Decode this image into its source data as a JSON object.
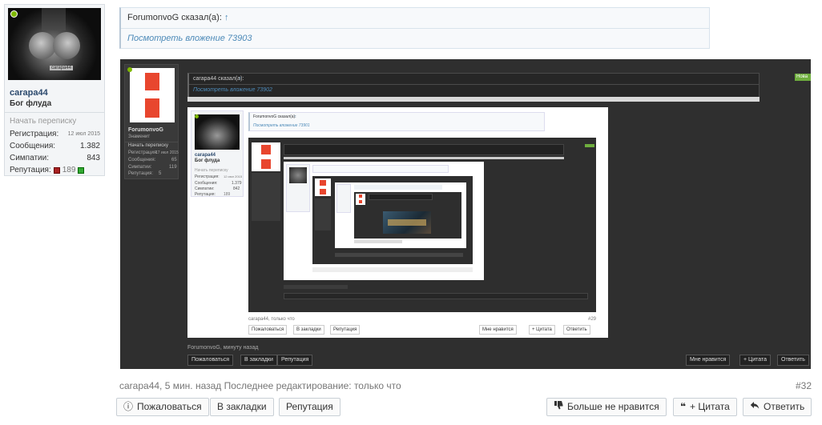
{
  "user": {
    "name": "carapa44",
    "title": "Бог флуда",
    "start_conversation": "Начать переписку",
    "stats": [
      {
        "label": "Регистрация:",
        "value": "12 июл 2015"
      },
      {
        "label": "Сообщения:",
        "value": "1.382"
      },
      {
        "label": "Симпатии:",
        "value": "843"
      }
    ],
    "reputation_label": "Репутация:",
    "reputation_value": "189",
    "avatar_tag": "carapa44"
  },
  "quote": {
    "author": "ForumonvoG сказал(а):",
    "arrow": "↑",
    "attachment_link": "Посмотреть вложение 73903"
  },
  "attachment": {
    "level1": {
      "quote_author": "carapa44 сказал(а):",
      "quote_arrow": "↑",
      "attachment_link": "Посмотреть вложение 73902",
      "new_badge": "Нова",
      "user_name": "ForumonvoG",
      "user_title": "Знаменит",
      "user_lines": [
        "Начать переписку",
        "Регистрация:",
        "Сообщения:",
        "Симпатии:",
        "Репутация:"
      ],
      "user_values": [
        "17 июл 2015",
        "65",
        "119",
        "5"
      ],
      "footer_meta": "ForumonvoG, минуту назад",
      "btn_report": "Пожаловаться",
      "btn_bookmark": "В закладки",
      "btn_rep": "Репутация",
      "btn_like": "Мне нравится",
      "btn_quote": "+ Цитата",
      "btn_reply": "Ответить"
    },
    "level2": {
      "user_name": "carapa44",
      "user_title": "Бог флуда",
      "user_lines": [
        "Начать переписку",
        "Регистрация:",
        "Сообщения:",
        "Симпатии:",
        "Репутация:"
      ],
      "user_values": [
        "12 июл 2015",
        "1.379",
        "842",
        "189"
      ],
      "quote_author": "ForumonvoG сказал(а):",
      "quote_arrow": "↑",
      "attachment_link": "Посмотреть вложение 73901",
      "footer_meta": "carapa44, только что",
      "post_num": "#29",
      "btn_report": "Пожаловаться",
      "btn_bookmark": "В закладки",
      "btn_rep": "Репутация",
      "btn_like": "Мне нравится",
      "btn_quote": "+ Цитата",
      "btn_reply": "Ответить"
    }
  },
  "post": {
    "meta": "carapa44, 5 мин. назад Последнее редактирование: только что",
    "number": "#32"
  },
  "actions": {
    "report": "Пожаловаться",
    "bookmark": "В закладки",
    "reputation": "Репутация",
    "unlike": "Больше не нравится",
    "quote": "+ Цитата",
    "reply": "Ответить"
  },
  "icons": {
    "report": "info-circle-icon",
    "unlike": "thumbs-down-icon",
    "quote": "quote-icon",
    "reply": "reply-arrow-icon"
  },
  "colors": {
    "link": "#4d8ab8",
    "online": "#7fb900",
    "logo_red": "#e8462e",
    "dark_bg": "#2f2f2f"
  }
}
